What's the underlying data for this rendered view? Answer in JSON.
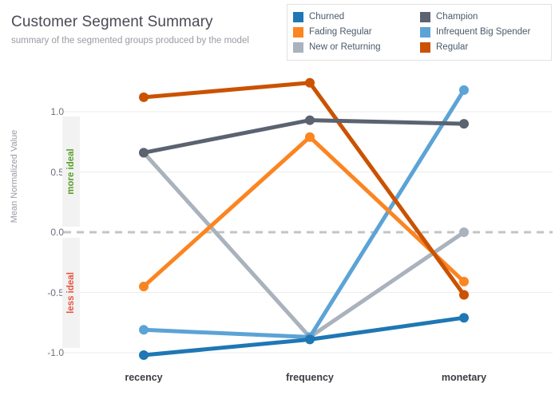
{
  "header": {
    "title": "Customer Segment Summary",
    "subtitle": "summary of the segmented groups produced by the model"
  },
  "legend": {
    "items": [
      {
        "label": "Churned",
        "color": "#1f77b4"
      },
      {
        "label": "Champion",
        "color": "#5b6270"
      },
      {
        "label": "Fading Regular",
        "color": "#fb8521"
      },
      {
        "label": "Infrequent Big Spender",
        "color": "#5ca3d6"
      },
      {
        "label": "New or Returning",
        "color": "#a9b2bd"
      },
      {
        "label": "Regular",
        "color": "#ca5201"
      }
    ]
  },
  "annotations": {
    "more_ideal": "more ideal",
    "less_ideal": "less ideal",
    "more_ideal_color": "#5aa02c",
    "less_ideal_color": "#e8543f",
    "zero_line_color": "#c4c4c4"
  },
  "chart_data": {
    "type": "line",
    "title": "Customer Segment Summary",
    "subtitle": "summary of the segmented groups produced by the model",
    "xlabel": "",
    "ylabel": "Mean Normalized Value",
    "categories": [
      "recency",
      "frequency",
      "monetary"
    ],
    "ylim": [
      -1.15,
      1.35
    ],
    "yticks": [
      1.0,
      0.5,
      0.0,
      -0.5,
      -1.0
    ],
    "ytick_labels": [
      "1.0",
      "0.5",
      "0.0",
      "-0.5",
      "-1.0"
    ],
    "grid": true,
    "legend_position": "top-right",
    "reference_line": 0.0,
    "series": [
      {
        "name": "Churned",
        "color": "#1f77b4",
        "values": [
          -1.02,
          -0.89,
          -0.71
        ]
      },
      {
        "name": "Fading Regular",
        "color": "#fb8521",
        "values": [
          -0.45,
          0.79,
          -0.41
        ]
      },
      {
        "name": "New or Returning",
        "color": "#a9b2bd",
        "values": [
          0.66,
          -0.87,
          0.0
        ]
      },
      {
        "name": "Champion",
        "color": "#5b6270",
        "values": [
          0.66,
          0.93,
          0.9
        ]
      },
      {
        "name": "Infrequent Big Spender",
        "color": "#5ca3d6",
        "values": [
          -0.81,
          -0.87,
          1.18
        ]
      },
      {
        "name": "Regular",
        "color": "#ca5201",
        "values": [
          1.12,
          1.24,
          -0.52
        ]
      }
    ]
  }
}
